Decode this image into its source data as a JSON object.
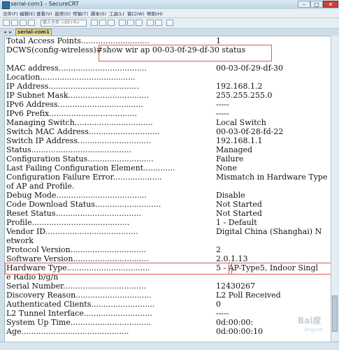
{
  "window": {
    "title": "serial-com1 - SecureCRT"
  },
  "menu": [
    "文件(F)",
    "编辑(E)",
    "查看(V)",
    "选项(O)",
    "传输(T)",
    "脚本(S)",
    "工具(L)",
    "窗口(W)",
    "帮助(H)"
  ],
  "toolbar": {
    "host_placeholder": "输入主机 <Alt+R>"
  },
  "tab": {
    "label": "serial-com1"
  },
  "terminal": {
    "lines": [
      {
        "label": "Total Access Points............................",
        "value": "1"
      },
      {
        "label": "DCWS(config-wireless)#show wir ap 00-03-0f-29-df-30 status",
        "value": ""
      },
      {
        "label": "",
        "value": ""
      },
      {
        "label": "MAC address....................................",
        "value": "00-03-0f-29-df-30"
      },
      {
        "label": "Location.......................................",
        "value": ""
      },
      {
        "label": "IP Address.....................................",
        "value": "192.168.1.2"
      },
      {
        "label": "IP Subnet Mask.................................",
        "value": "255.255.255.0"
      },
      {
        "label": "IPv6 Address...................................",
        "value": "-----"
      },
      {
        "label": "IPv6 Prefix....................................",
        "value": "-----"
      },
      {
        "label": "Managing Switch................................",
        "value": "Local Switch"
      },
      {
        "label": "Switch MAC Address.............................",
        "value": "00-03-0f-28-fd-22"
      },
      {
        "label": "Switch IP Address..............................",
        "value": "192.168.1.1"
      },
      {
        "label": "Status.........................................",
        "value": "Managed"
      },
      {
        "label": "Configuration Status...........................",
        "value": "Failure"
      },
      {
        "label": "Last Failing Configuration Element.............",
        "value": "None"
      },
      {
        "label": "Configuration Failure Error....................",
        "value": "Mismatch in Hardware Type"
      },
      {
        "label": "of AP and Profile.",
        "value": ""
      },
      {
        "label": "Debug Mode.....................................",
        "value": "Disable"
      },
      {
        "label": "Code Download Status...........................",
        "value": "Not Started"
      },
      {
        "label": "Reset Status...................................",
        "value": "Not Started"
      },
      {
        "label": "Profile........................................",
        "value": "1 - Default"
      },
      {
        "label": "Vendor ID......................................",
        "value": "Digital China (Shanghai) N"
      },
      {
        "label": "etwork",
        "value": ""
      },
      {
        "label": "Protocol Version...............................",
        "value": "2"
      },
      {
        "label": "Software Version...............................",
        "value": "2.0.1.13"
      },
      {
        "label": "Hardware Type..................................",
        "value": "5 - AP-Type5, Indoor Singl"
      },
      {
        "label": "e Radio b/g/n",
        "value": ""
      },
      {
        "label": "Serial Number..................................",
        "value": "12430267"
      },
      {
        "label": "Discovery Reason...............................",
        "value": "L2 Poll Received"
      },
      {
        "label": "Authenticated Clients..........................",
        "value": "0"
      },
      {
        "label": "L2 Tunnel Interface............................",
        "value": "-----"
      },
      {
        "label": "System Up Time.................................",
        "value": "0d:00:00:"
      },
      {
        "label": "Age............................................",
        "value": "0d:00:00:10"
      }
    ]
  },
  "watermark": {
    "text": "Bai度",
    "sub": "jingyan"
  },
  "colors": {
    "highlight_box": "#e05a5a",
    "tab_active": "#e6d68a"
  }
}
